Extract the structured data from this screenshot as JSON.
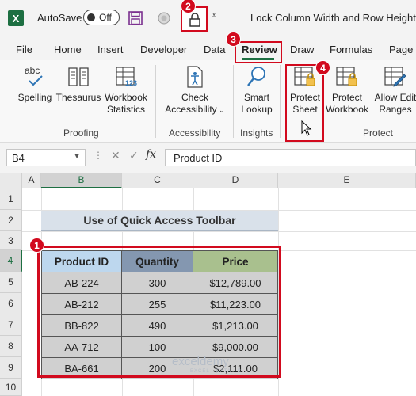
{
  "titlebar": {
    "app_icon": "X",
    "autosave_label": "AutoSave",
    "autosave_state": "Off",
    "title": "Lock Column Width and Row Height",
    "lock_button_icon": "lock-icon"
  },
  "badges": [
    "1",
    "2",
    "3",
    "4"
  ],
  "tabs": [
    "File",
    "Home",
    "Insert",
    "Developer",
    "Data",
    "Review",
    "Draw",
    "Formulas",
    "Page"
  ],
  "ribbon": {
    "spelling": {
      "icon_text": "abc",
      "label": "Spelling"
    },
    "thesaurus": "Thesaurus",
    "workbook_statistics": [
      "Workbook",
      "Statistics"
    ],
    "statistics_icon_text": "123",
    "proofing_label": "Proofing",
    "check_accessibility": [
      "Check",
      "Accessibility"
    ],
    "accessibility_label": "Accessibility",
    "smart_lookup": [
      "Smart",
      "Lookup"
    ],
    "insights_label": "Insights",
    "protect_sheet": [
      "Protect",
      "Sheet"
    ],
    "protect_workbook": [
      "Protect",
      "Workbook"
    ],
    "allow_edit_ranges": [
      "Allow Edit",
      "Ranges"
    ],
    "protect_label": "Protect"
  },
  "formula_bar": {
    "name_box": "B4",
    "dots": "⋮",
    "cancel": "✕",
    "enter": "✓",
    "fx": "fx",
    "value": "Product ID"
  },
  "sheet": {
    "columns": [
      "A",
      "B",
      "C",
      "D",
      "E"
    ],
    "rows": [
      "1",
      "2",
      "3",
      "4",
      "5",
      "6",
      "7",
      "8",
      "9",
      "10"
    ],
    "title": "Use of Quick Access Toolbar",
    "table": {
      "headers": [
        "Product ID",
        "Quantity",
        "Price"
      ],
      "header_colors": [
        "#bdd7ee",
        "#8497b0",
        "#a9c08e"
      ],
      "rows": [
        [
          "AB-224",
          "300",
          "$12,789.00"
        ],
        [
          "AB-212",
          "255",
          "$11,223.00"
        ],
        [
          "BB-822",
          "490",
          "$1,213.00"
        ],
        [
          "AA-712",
          "100",
          "$9,000.00"
        ],
        [
          "BA-661",
          "200",
          "$2,111.00"
        ]
      ]
    },
    "watermark": "exceldemy",
    "watermark_sub": "EXCEL · DATA · BI"
  },
  "colors": {
    "annotation_red": "#d20a1e",
    "excel_green": "#1d6f42"
  }
}
